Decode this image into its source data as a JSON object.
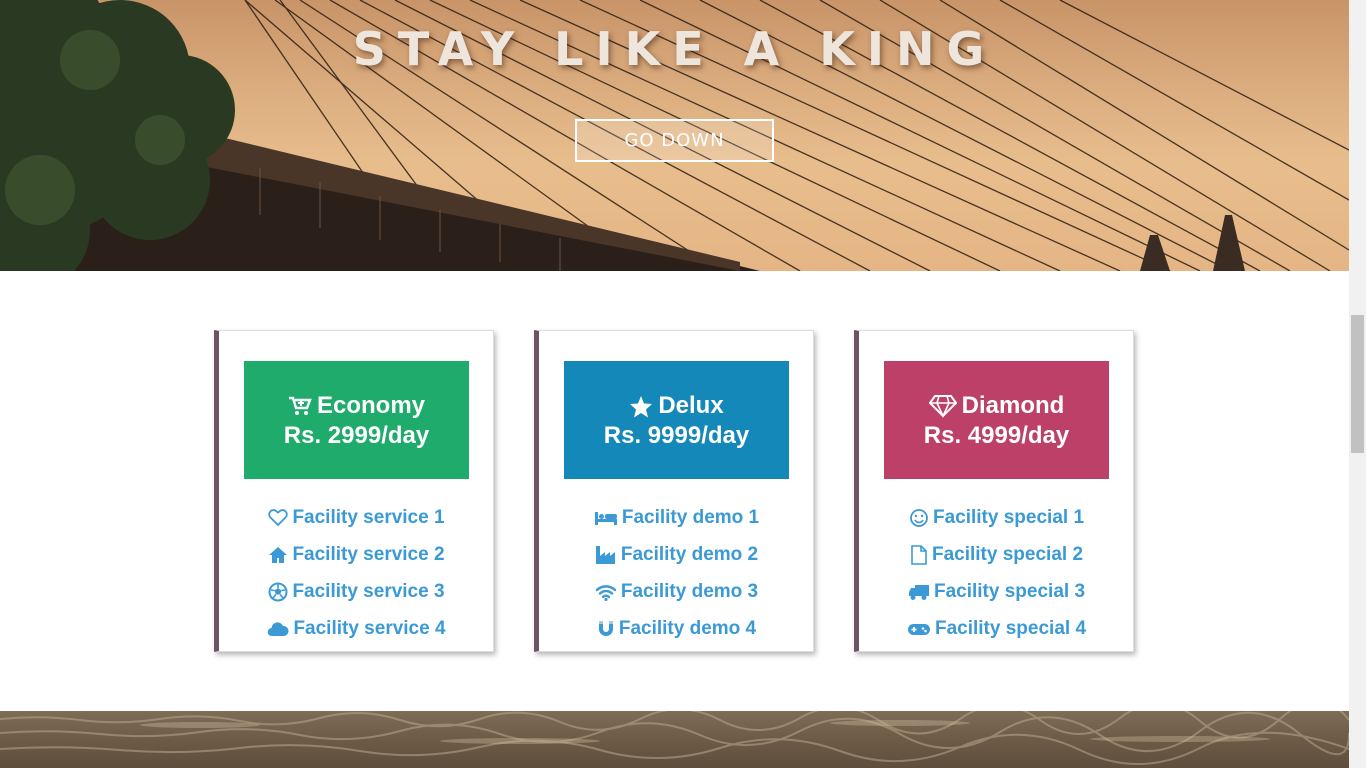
{
  "hero": {
    "title": "STAY LIKE A KING",
    "button_label": "GO DOWN"
  },
  "plans": [
    {
      "name": "Economy",
      "price": "Rs. 2999/day",
      "color": "#1eab6b",
      "icon": "cart-plus-icon",
      "features": [
        {
          "label": "Facility service 1",
          "icon": "heart-icon"
        },
        {
          "label": "Facility service 2",
          "icon": "home-icon"
        },
        {
          "label": "Facility service 3",
          "icon": "soccer-ball-icon"
        },
        {
          "label": "Facility service 4",
          "icon": "cloud-icon"
        }
      ]
    },
    {
      "name": "Delux",
      "price": "Rs. 9999/day",
      "color": "#1488b8",
      "icon": "star-icon",
      "features": [
        {
          "label": "Facility demo 1",
          "icon": "bed-icon"
        },
        {
          "label": "Facility demo 2",
          "icon": "industry-icon"
        },
        {
          "label": "Facility demo 3",
          "icon": "wifi-icon"
        },
        {
          "label": "Facility demo 4",
          "icon": "magnet-icon"
        }
      ]
    },
    {
      "name": "Diamond",
      "price": "Rs. 4999/day",
      "color": "#bd4068",
      "icon": "diamond-icon",
      "features": [
        {
          "label": "Facility special 1",
          "icon": "smile-icon"
        },
        {
          "label": "Facility special 2",
          "icon": "file-icon"
        },
        {
          "label": "Facility special 3",
          "icon": "truck-icon"
        },
        {
          "label": "Facility special 4",
          "icon": "gamepad-icon"
        }
      ]
    }
  ],
  "colors": {
    "feature_text": "#3b9ad6",
    "card_accent": "#6e5566"
  }
}
